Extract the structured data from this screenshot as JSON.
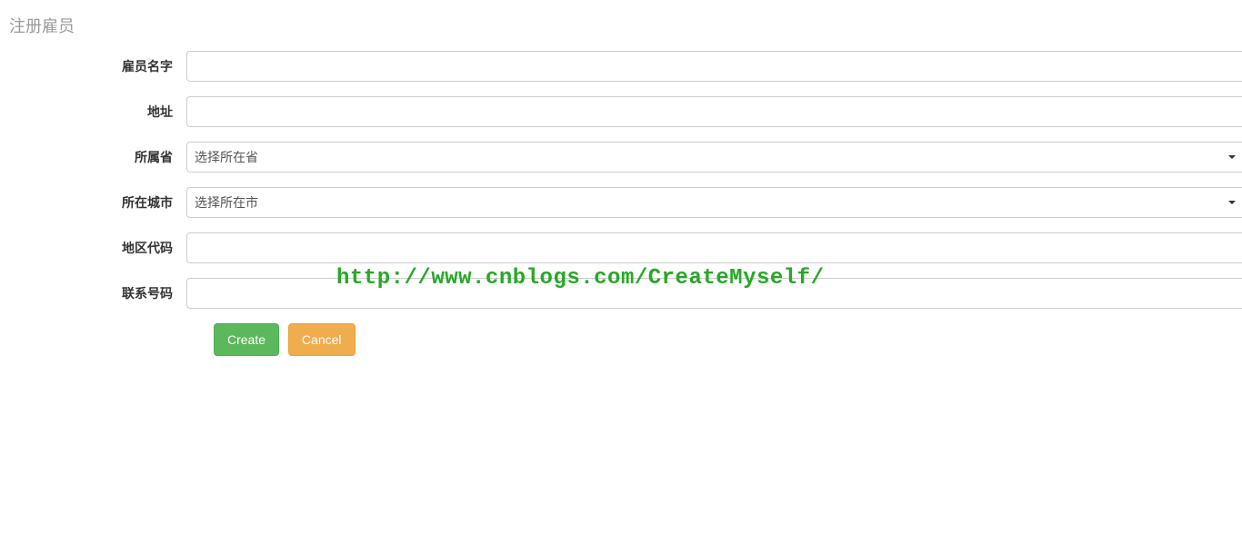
{
  "page": {
    "title": "注册雇员"
  },
  "form": {
    "fields": {
      "name": {
        "label": "雇员名字",
        "value": ""
      },
      "address": {
        "label": "地址",
        "value": ""
      },
      "province": {
        "label": "所属省",
        "selected": "选择所在省"
      },
      "city": {
        "label": "所在城市",
        "selected": "选择所在市"
      },
      "areacode": {
        "label": "地区代码",
        "value": ""
      },
      "phone": {
        "label": "联系号码",
        "value": ""
      }
    },
    "buttons": {
      "create": "Create",
      "cancel": "Cancel"
    }
  },
  "watermark": "http://www.cnblogs.com/CreateMyself/"
}
